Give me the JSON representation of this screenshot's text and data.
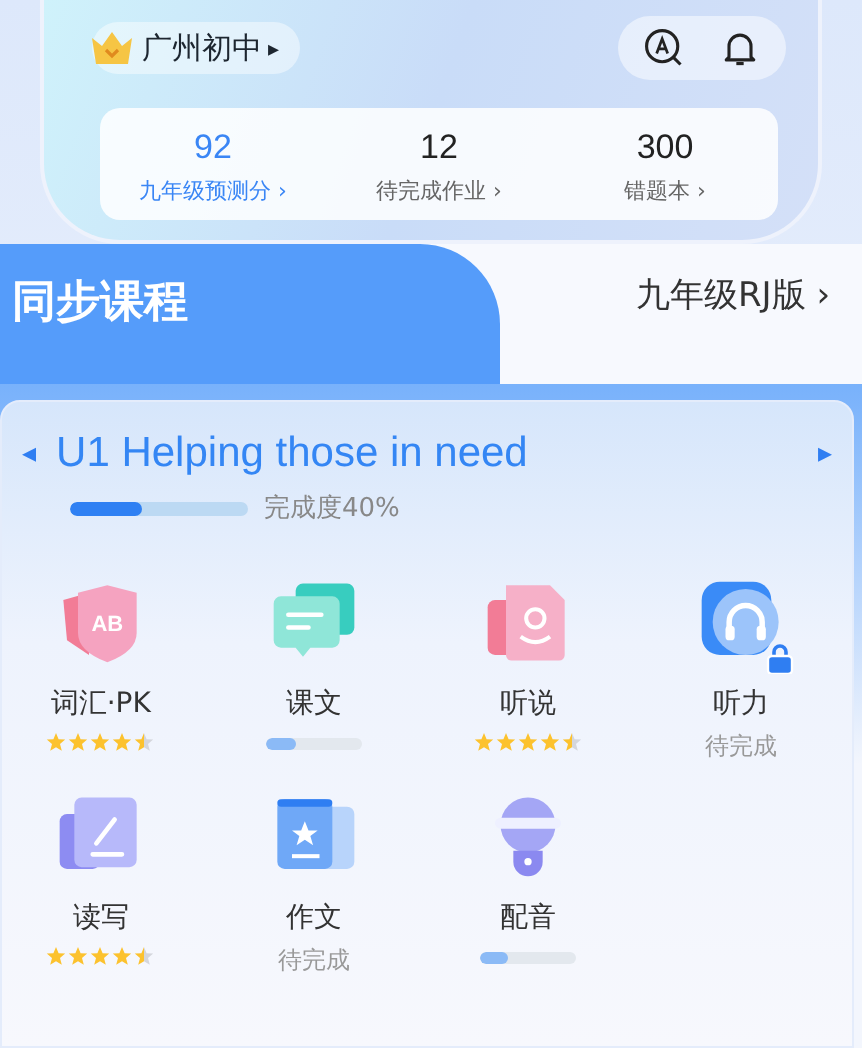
{
  "header": {
    "school": "广州初中",
    "school_arrow": "▸"
  },
  "stats": [
    {
      "value": "92",
      "label": "九年级预测分",
      "arrow": "›",
      "highlight": true
    },
    {
      "value": "12",
      "label": "待完成作业",
      "arrow": "›",
      "highlight": false
    },
    {
      "value": "300",
      "label": "错题本",
      "arrow": "›",
      "highlight": false
    }
  ],
  "section": {
    "title": "同步课程",
    "edition": "九年级RJ版",
    "edition_arrow": "›"
  },
  "unit": {
    "prev": "◂",
    "title": "U1 Helping those in need",
    "next": "▸",
    "progress": {
      "level": 0.4,
      "label": "完成度40%"
    }
  },
  "modules": [
    {
      "name": "词汇·PK",
      "icon_text": "AB",
      "kind": "stars",
      "stars": 4.5
    },
    {
      "name": "课文",
      "kind": "progress",
      "level": 0.3
    },
    {
      "name": "听说",
      "kind": "stars",
      "stars": 4.5
    },
    {
      "name": "听力",
      "kind": "status",
      "status": "待完成",
      "locked": true
    },
    {
      "name": "读写",
      "kind": "stars",
      "stars": 4.5
    },
    {
      "name": "作文",
      "kind": "status",
      "status": "待完成"
    },
    {
      "name": "配音",
      "kind": "progress",
      "level": 0.3
    }
  ]
}
